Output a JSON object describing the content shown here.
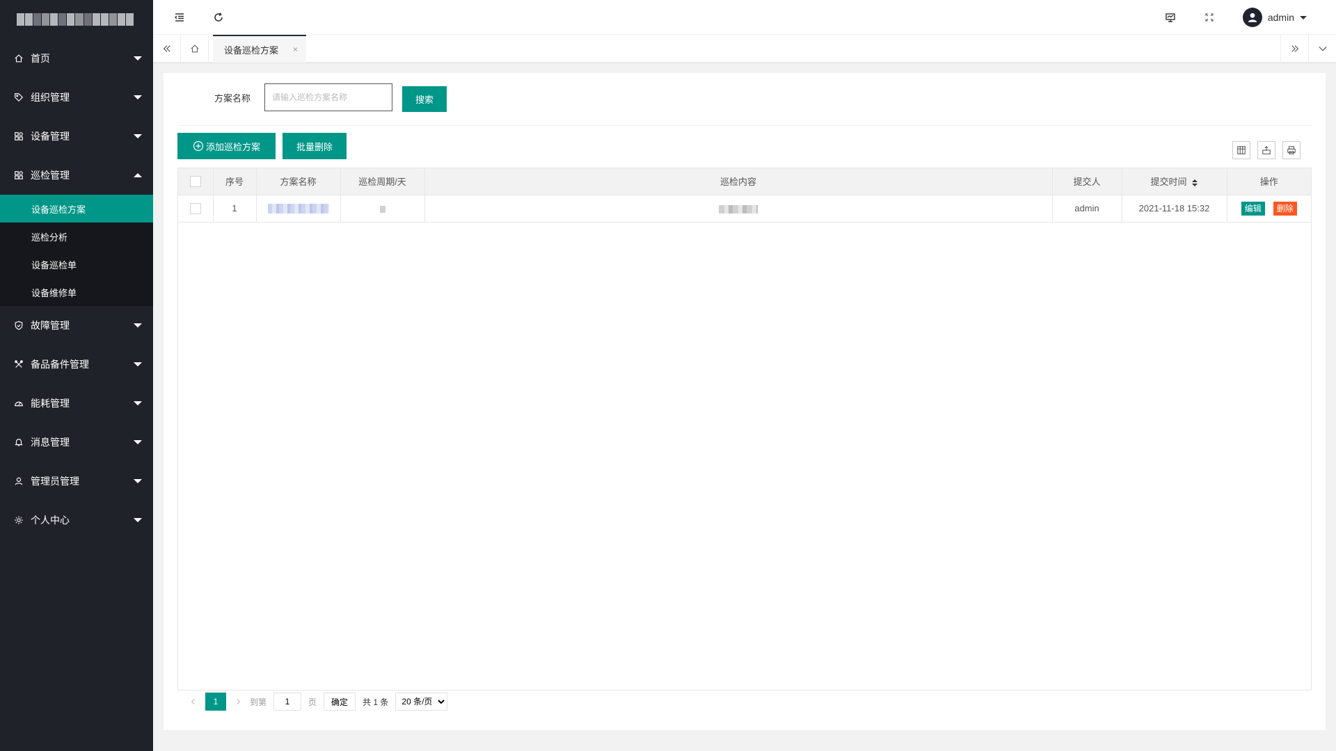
{
  "sidebar": {
    "items": [
      {
        "label": "首页",
        "icon": "home-icon"
      },
      {
        "label": "组织管理",
        "icon": "tag-icon"
      },
      {
        "label": "设备管理",
        "icon": "apps-icon"
      },
      {
        "label": "巡检管理",
        "icon": "apps-icon"
      },
      {
        "label": "故障管理",
        "icon": "shield-icon"
      },
      {
        "label": "备品备件管理",
        "icon": "tools-icon"
      },
      {
        "label": "能耗管理",
        "icon": "gauge-icon"
      },
      {
        "label": "消息管理",
        "icon": "bell-icon"
      },
      {
        "label": "管理员管理",
        "icon": "user-icon"
      },
      {
        "label": "个人中心",
        "icon": "gear-icon"
      }
    ],
    "submenu": [
      {
        "label": "设备巡检方案"
      },
      {
        "label": "巡检分析"
      },
      {
        "label": "设备巡检单"
      },
      {
        "label": "设备维修单"
      }
    ]
  },
  "header": {
    "user_name": "admin"
  },
  "tabs": {
    "active_label": "设备巡检方案",
    "close_label": "×"
  },
  "search": {
    "label": "方案名称",
    "placeholder": "请输入巡检方案名称",
    "button": "搜索"
  },
  "toolbar": {
    "add_label": "添加巡检方案",
    "batch_delete_label": "批量删除"
  },
  "table": {
    "headers": [
      "序号",
      "方案名称",
      "巡检周期/天",
      "巡检内容",
      "提交人",
      "提交时间",
      "操作"
    ],
    "rows": [
      {
        "index": "1",
        "submitter": "admin",
        "time": "2021-11-18 15:32",
        "edit": "编辑",
        "delete": "删除"
      }
    ]
  },
  "pagination": {
    "current": "1",
    "goto_label": "到第",
    "goto_value": "1",
    "page_suffix": "页",
    "confirm": "确定",
    "total": "共 1 条",
    "page_size": "20 条/页"
  },
  "colors": {
    "sidebar_bg": "#20222a",
    "accent": "#009688",
    "danger": "#ff5722"
  }
}
